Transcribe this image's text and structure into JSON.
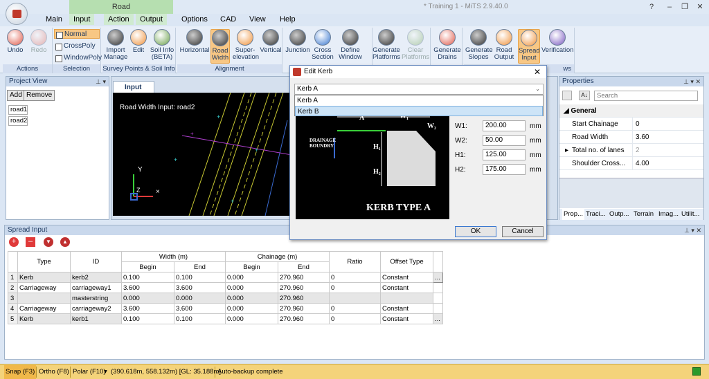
{
  "window": {
    "title": "* Training 1 - MiTS 2.9.40.0",
    "help": "?",
    "minimize": "–",
    "restore": "❐",
    "close": "✕"
  },
  "context_tab": "Road",
  "tabs": [
    "Main",
    "Input",
    "Action",
    "Output",
    "Options",
    "CAD",
    "View",
    "Help"
  ],
  "ribbon": {
    "actions": {
      "label": "Actions",
      "undo": "Undo",
      "redo": "Redo"
    },
    "selection": {
      "label": "Selection",
      "normal": "Normal",
      "crosspoly": "CrossPoly",
      "windowpoly": "WindowPoly"
    },
    "survey": {
      "label": "Survey Points & Soil Info",
      "import": "Import",
      "manage": "Manage",
      "edit": "Edit",
      "soil_info": "Soil Info",
      "beta": "(BETA)"
    },
    "alignment": {
      "label": "Alignment",
      "horizontal": "Horizontal",
      "road": "Road",
      "width": "Width",
      "super": "Super-",
      "elevation": "elevation",
      "vertical": "Vertical"
    },
    "junction": "Junction",
    "cross": "Cross",
    "section": "Section",
    "define": "Define",
    "window_lbl": "Window",
    "generate": "Generate",
    "platforms": "Platforms",
    "clear": "Clear",
    "drains": "Drains",
    "slopes": "Slopes",
    "road_lbl": "Road",
    "output_lbl": "Output",
    "spread": "Spread",
    "input_lbl": "Input",
    "verification": "Verification",
    "views_tail": "ws"
  },
  "project_view": {
    "title": "Project View",
    "add": "Add",
    "remove": "Remove",
    "items": [
      "road1",
      "road2"
    ]
  },
  "doc_tab": "Input",
  "canvas": {
    "label": "Road Width Input: road2",
    "y_axis": "Y",
    "z_axis": "Z"
  },
  "dialog": {
    "title": "Edit Kerb",
    "selected": "Kerb A",
    "options": [
      "Kerb A",
      "Kerb B"
    ],
    "image_title": "KERB TYPE A",
    "drainage": "DRAINAGE",
    "boundry": "BOUNDRY",
    "fields": [
      {
        "label": "W1:",
        "value": "200.00",
        "unit": "mm"
      },
      {
        "label": "W2:",
        "value": "50.00",
        "unit": "mm"
      },
      {
        "label": "H1:",
        "value": "125.00",
        "unit": "mm"
      },
      {
        "label": "H2:",
        "value": "175.00",
        "unit": "mm"
      }
    ],
    "ok": "OK",
    "cancel": "Cancel"
  },
  "properties": {
    "title": "Properties",
    "search_placeholder": "Search",
    "category": "General",
    "rows": [
      {
        "key": "Start Chainage",
        "value": "0"
      },
      {
        "key": "Road Width",
        "value": "3.60"
      },
      {
        "key": "Total no. of lanes",
        "value": "2"
      },
      {
        "key": "Shoulder Cross...",
        "value": "4.00"
      }
    ],
    "tabs": [
      "Prop...",
      "Traci...",
      "Outp...",
      "Terrain",
      "Imag...",
      "Utilit..."
    ]
  },
  "spread_input": {
    "title": "Spread Input",
    "headers": {
      "type": "Type",
      "id": "ID",
      "width": "Width (m)",
      "chainage": "Chainage (m)",
      "begin": "Begin",
      "end": "End",
      "ratio": "Ratio",
      "offset_type": "Offset Type"
    },
    "rows": [
      {
        "n": "1",
        "type": "Kerb",
        "id": "kerb2",
        "wb": "0.100",
        "we": "0.100",
        "cb": "0.000",
        "ce": "270.960",
        "ratio": "0",
        "offset": "Constant",
        "btn": "..."
      },
      {
        "n": "2",
        "type": "Carriageway",
        "id": "carriageway1",
        "wb": "3.600",
        "we": "3.600",
        "cb": "0.000",
        "ce": "270.960",
        "ratio": "0",
        "offset": "Constant",
        "btn": ""
      },
      {
        "n": "3",
        "type": "",
        "id": "masterstring",
        "wb": "0.000",
        "we": "0.000",
        "cb": "0.000",
        "ce": "270.960",
        "ratio": "",
        "offset": "",
        "btn": ""
      },
      {
        "n": "4",
        "type": "Carriageway",
        "id": "carriageway2",
        "wb": "3.600",
        "we": "3.600",
        "cb": "0.000",
        "ce": "270.960",
        "ratio": "0",
        "offset": "Constant",
        "btn": ""
      },
      {
        "n": "5",
        "type": "Kerb",
        "id": "kerb1",
        "wb": "0.100",
        "we": "0.100",
        "cb": "0.000",
        "ce": "270.960",
        "ratio": "0",
        "offset": "Constant",
        "btn": "..."
      }
    ]
  },
  "status": {
    "snap": "Snap (F3)",
    "ortho": "Ortho (F8)",
    "polar": "Polar (F10)",
    "coords": "(390.618m, 558.132m) [GL: 35.188m]",
    "message": "Auto-backup complete"
  }
}
